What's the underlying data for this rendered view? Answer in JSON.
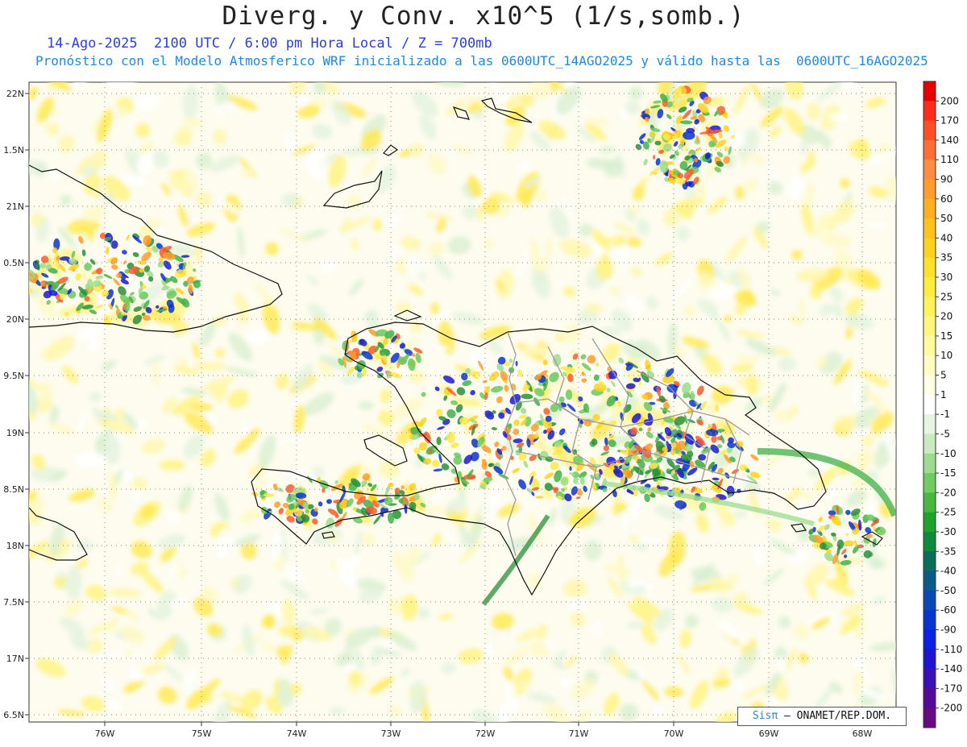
{
  "title": "Diverg. y Conv. x10^5 (1/s,somb.)",
  "subtitle_date": "14-Ago-2025  2100 UTC / 6:00 pm Hora Local / Z = 700mb",
  "subtitle_run": "Pronóstico con el Modelo Atmosferico WRF inicializado a las 0600UTC_14AGO2025 y válido hasta las  0600UTC_16AGO2025",
  "lat_labels": [
    "22N",
    "1.5N",
    "21N",
    "0.5N",
    "20N",
    "9.5N",
    "19N",
    "8.5N",
    "18N",
    "7.5N",
    "17N",
    "6.5N"
  ],
  "lon_labels": [
    "76W",
    "75W",
    "74W",
    "73W",
    "72W",
    "71W",
    "70W",
    "69W",
    "68W"
  ],
  "colorbar": {
    "labels": [
      "200",
      "170",
      "140",
      "110",
      "90",
      "60",
      "50",
      "40",
      "35",
      "30",
      "25",
      "20",
      "15",
      "10",
      "5",
      "1",
      "-1",
      "-5",
      "-10",
      "-15",
      "-20",
      "-25",
      "-30",
      "-35",
      "-40",
      "-50",
      "-60",
      "-90",
      "-110",
      "-140",
      "-170",
      "-200"
    ],
    "colors": [
      "#e80000",
      "#ff2a1a",
      "#ff4e2a",
      "#ff6e36",
      "#ff8c40",
      "#ff9e2a",
      "#ffb020",
      "#ffc21e",
      "#ffd21e",
      "#ffe02a",
      "#ffec3c",
      "#fff35a",
      "#fff77c",
      "#fffaa0",
      "#fffcc4",
      "#ffffe6",
      "#ffffff",
      "#e6f5e1",
      "#c8ebbf",
      "#9cdc8f",
      "#70cc62",
      "#46b83e",
      "#1ea32a",
      "#0d8a3a",
      "#0a6e5a",
      "#0a5a8a",
      "#0a48b4",
      "#0a34d2",
      "#0a22e6",
      "#1e14d2",
      "#3a10b4",
      "#560a96",
      "#6a0a82"
    ]
  },
  "credit": {
    "brand": "Sisπ",
    "text": " – ONAMET/REP.DOM."
  }
}
